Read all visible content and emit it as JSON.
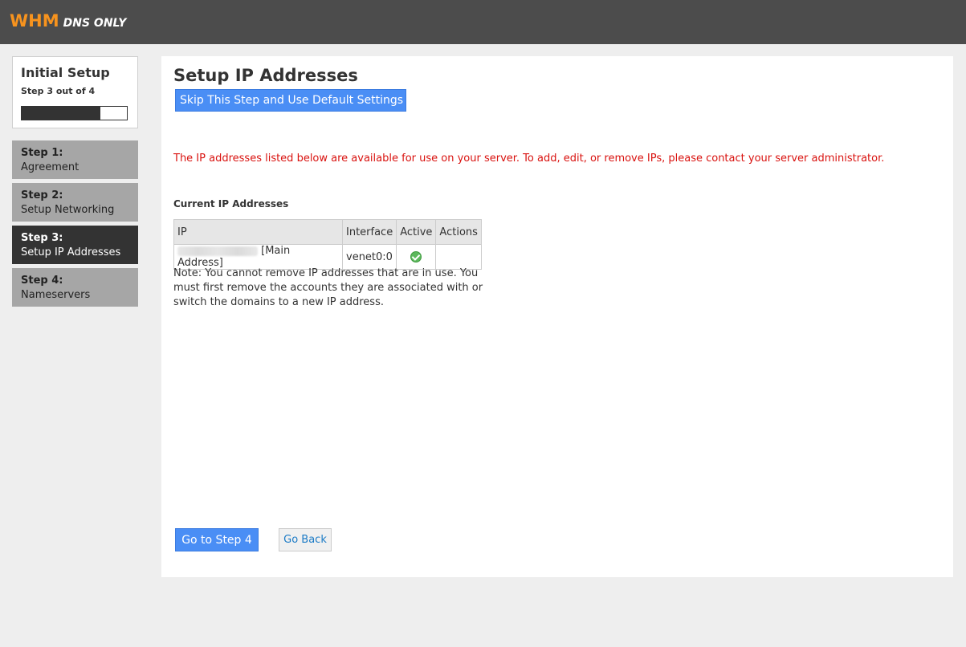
{
  "brand": {
    "logo_main": "WHM",
    "logo_sub": "DNS ONLY",
    "accent": "#f7931e"
  },
  "sidebar": {
    "title": "Initial Setup",
    "progress_text": "Step 3 out of 4",
    "progress_fraction": 0.75,
    "steps": [
      {
        "num": "Step 1:",
        "label": "Agreement",
        "active": false
      },
      {
        "num": "Step 2:",
        "label": "Setup Networking",
        "active": false
      },
      {
        "num": "Step 3:",
        "label": "Setup IP Addresses",
        "active": true
      },
      {
        "num": "Step 4:",
        "label": "Nameservers",
        "active": false
      }
    ]
  },
  "main": {
    "title": "Setup IP Addresses",
    "skip_button": "Skip This Step and Use Default Settings",
    "notice": "The IP addresses listed below are available for use on your server. To add, edit, or remove IPs, please contact your server administrator.",
    "section_heading": "Current IP Addresses",
    "table": {
      "headers": [
        "IP",
        "Interface",
        "Active",
        "Actions"
      ],
      "rows": [
        {
          "ip_note": "[Main Address]",
          "interface": "venet0:0",
          "active": true,
          "actions": ""
        }
      ]
    },
    "note": "Note: You cannot remove IP addresses that are in use. You must first remove the accounts they are associated with or switch the domains to a new IP address.",
    "next_button": "Go to Step 4",
    "back_button": "Go Back"
  }
}
